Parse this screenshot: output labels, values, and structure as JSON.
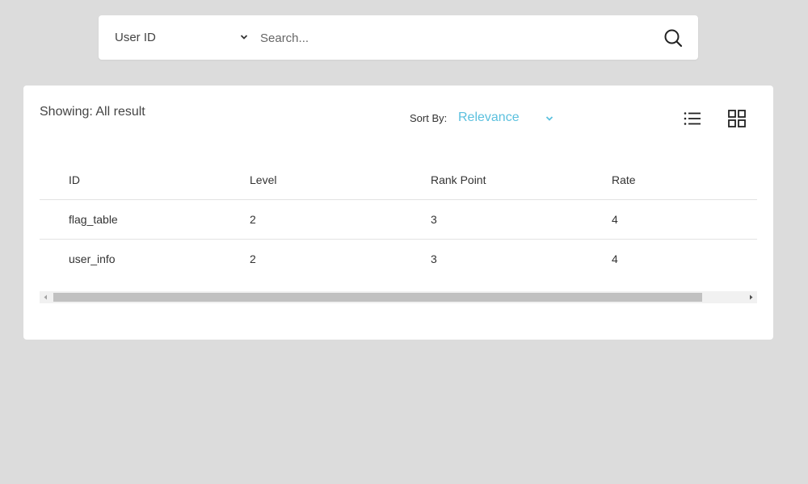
{
  "search": {
    "type_label": "User ID",
    "placeholder": "Search..."
  },
  "results": {
    "showing": "Showing: All result",
    "sort_label": "Sort By:",
    "sort_value": "Relevance"
  },
  "table": {
    "headers": [
      "ID",
      "Level",
      "Rank Point",
      "Rate"
    ],
    "rows": [
      [
        "flag_table",
        "2",
        "3",
        "4"
      ],
      [
        "user_info",
        "2",
        "3",
        "4"
      ]
    ]
  },
  "colors": {
    "accent": "#5bc0de",
    "background": "#dcdcdc",
    "panel": "#ffffff"
  },
  "icons": {
    "search": "search-icon",
    "list_view": "list-view-icon",
    "grid_view": "grid-view-icon",
    "dropdown": "chevron-down-icon"
  }
}
